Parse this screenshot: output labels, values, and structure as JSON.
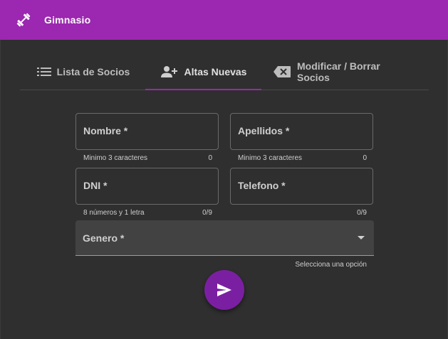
{
  "app": {
    "title": "Gimnasio",
    "logo_icon": "fitness-center-icon",
    "accent": "#9c27b0"
  },
  "tabs": [
    {
      "label": "Lista de Socios",
      "icon": "list-icon",
      "active": false
    },
    {
      "label": "Altas Nuevas",
      "icon": "person-add-icon",
      "active": true
    },
    {
      "label": "Modificar / Borrar Socios",
      "icon": "backspace-icon",
      "active": false
    }
  ],
  "form": {
    "nombre": {
      "label": "Nombre *",
      "hint": "Minimo 3 caracteres",
      "counter": "0"
    },
    "apellidos": {
      "label": "Apellidos *",
      "hint": "Minimo 3 caracteres",
      "counter": "0"
    },
    "dni": {
      "label": "DNI *",
      "hint": "8 números y 1 letra",
      "counter": "0/9"
    },
    "telefono": {
      "label": "Telefono *",
      "hint": "",
      "counter": "0/9"
    },
    "genero": {
      "label": "Genero *",
      "hint": "Selecciona una opción"
    }
  },
  "submit": {
    "icon": "send-icon"
  }
}
